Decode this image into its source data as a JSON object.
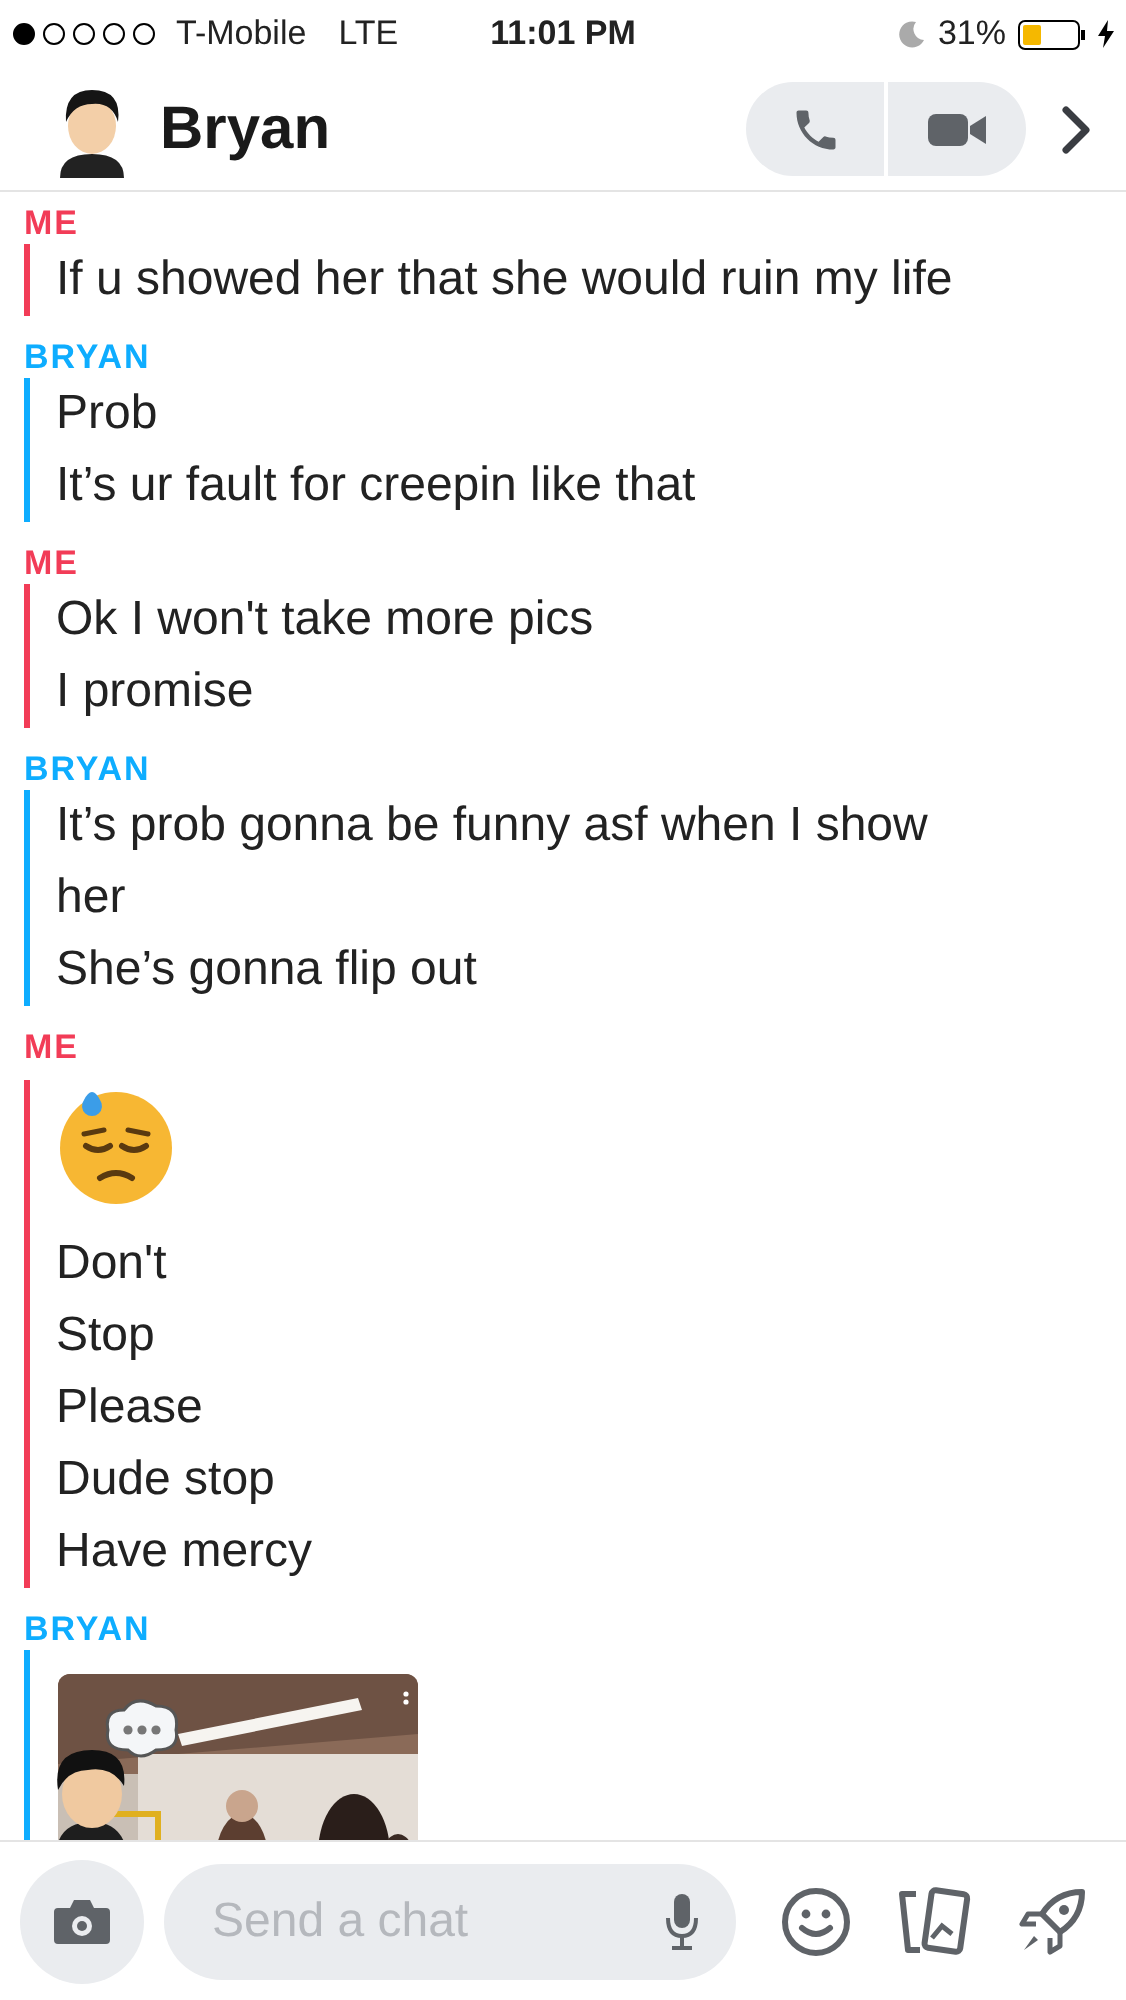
{
  "status_bar": {
    "carrier": "T-Mobile",
    "network": "LTE",
    "time": "11:01 PM",
    "battery": "31%"
  },
  "header": {
    "name": "Bryan"
  },
  "messages": [
    {
      "sender": "ME",
      "color": "#f23c57",
      "items": [
        {
          "kind": "text",
          "text": "If u showed her that she would ruin my life"
        }
      ]
    },
    {
      "sender": "BRYAN",
      "color": "#0eadff",
      "items": [
        {
          "kind": "text",
          "text": "Prob"
        },
        {
          "kind": "text",
          "text": "It’s ur fault for creepin like that"
        }
      ]
    },
    {
      "sender": "ME",
      "color": "#f23c57",
      "items": [
        {
          "kind": "text",
          "text": "Ok I won't take more pics"
        },
        {
          "kind": "text",
          "text": "I promise"
        }
      ]
    },
    {
      "sender": "BRYAN",
      "color": "#0eadff",
      "items": [
        {
          "kind": "text",
          "text": "It’s prob gonna be funny asf when I show her"
        },
        {
          "kind": "text",
          "text": "She’s gonna flip out"
        }
      ]
    },
    {
      "sender": "ME",
      "color": "#f23c57",
      "items": [
        {
          "kind": "emoji"
        },
        {
          "kind": "text",
          "text": "Don't"
        },
        {
          "kind": "text",
          "text": "Stop"
        },
        {
          "kind": "text",
          "text": "Please"
        },
        {
          "kind": "text",
          "text": "Dude stop"
        },
        {
          "kind": "text",
          "text": "Have mercy"
        }
      ]
    },
    {
      "sender": "BRYAN",
      "color": "#0eadff"
    }
  ],
  "composer": {
    "placeholder": "Send a chat"
  }
}
